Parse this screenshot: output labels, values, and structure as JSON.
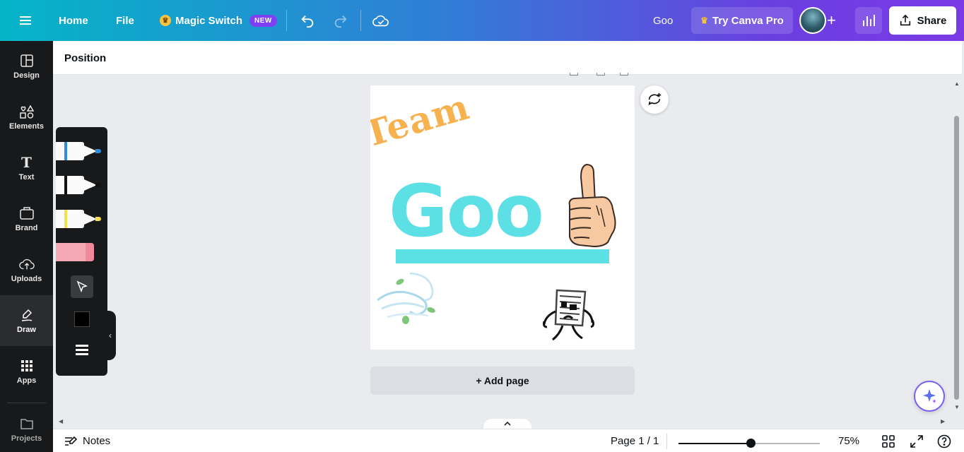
{
  "topbar": {
    "home": "Home",
    "file": "File",
    "magic_switch": "Magic Switch",
    "new_badge": "NEW",
    "doc_title": "Goo",
    "try_pro": "Try Canva Pro",
    "share": "Share"
  },
  "sidebar": {
    "items": [
      {
        "label": "Design",
        "icon": "design-icon"
      },
      {
        "label": "Elements",
        "icon": "elements-icon"
      },
      {
        "label": "Text",
        "icon": "text-icon"
      },
      {
        "label": "Brand",
        "icon": "brand-icon"
      },
      {
        "label": "Uploads",
        "icon": "uploads-icon"
      },
      {
        "label": "Draw",
        "icon": "draw-icon"
      },
      {
        "label": "Apps",
        "icon": "apps-icon"
      },
      {
        "label": "Projects",
        "icon": "projects-icon"
      }
    ],
    "active": "Draw"
  },
  "position_bar": {
    "label": "Position"
  },
  "draw_panel": {
    "tools": [
      {
        "name": "pen",
        "color": "#2d8ee0"
      },
      {
        "name": "marker",
        "color": "#111111"
      },
      {
        "name": "highlighter",
        "color": "#f4e04a"
      },
      {
        "name": "eraser",
        "color": "#f6a8b4"
      }
    ],
    "stroke_color": "#000000"
  },
  "canvas": {
    "team_text": "Team",
    "goo_text": "Goo",
    "team_color": "#f7b14f",
    "goo_color": "#5ce0e6"
  },
  "add_page": "+ Add page",
  "bottombar": {
    "notes": "Notes",
    "page_info": "Page 1 / 1",
    "zoom": "75%",
    "zoom_level": 0.75
  }
}
